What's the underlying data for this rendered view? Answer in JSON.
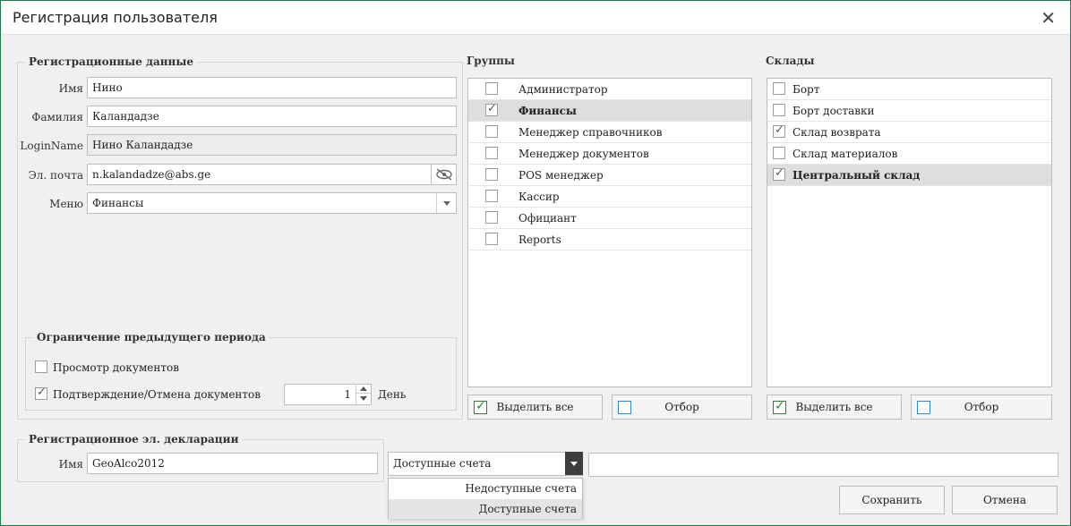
{
  "window": {
    "title": "Регистрация пользователя",
    "close_glyph": "✕"
  },
  "registration": {
    "legend": "Регистрационные данные",
    "first_name": {
      "label": "Имя",
      "value": "Нино"
    },
    "last_name": {
      "label": "Фамилия",
      "value": "Каландадзе"
    },
    "login": {
      "label": "LoginName",
      "value": "Нино Каландадзе"
    },
    "email": {
      "label": "Эл. почта",
      "value": "n.kalandadze@abs.ge",
      "icon": "eye-hidden-icon"
    },
    "menu": {
      "label": "Меню",
      "value": "Финансы"
    }
  },
  "restriction": {
    "legend": "Ограничение предыдущего периода",
    "view_docs": {
      "label": "Просмотр документов",
      "checked": false
    },
    "confirm_docs": {
      "label": "Подтверждение/Отмена документов",
      "checked": true
    },
    "days": {
      "value": "1",
      "unit": "День"
    }
  },
  "groups": {
    "legend": "Группы",
    "items": [
      {
        "label": "Администратор",
        "checked": false
      },
      {
        "label": "Финансы",
        "checked": true
      },
      {
        "label": "Менеджер справочников",
        "checked": false
      },
      {
        "label": "Менеджер документов",
        "checked": false
      },
      {
        "label": "POS менеджер",
        "checked": false
      },
      {
        "label": "Кассир",
        "checked": false
      },
      {
        "label": "Официант",
        "checked": false
      },
      {
        "label": "Reports",
        "checked": false
      }
    ],
    "select_all": "Выделить все",
    "filter": "Отбор"
  },
  "warehouses": {
    "legend": "Склады",
    "items": [
      {
        "label": "Борт",
        "checked": false
      },
      {
        "label": "Борт доставки",
        "checked": false
      },
      {
        "label": "Склад возврата",
        "checked": true
      },
      {
        "label": "Склад материалов",
        "checked": false
      },
      {
        "label": "Центральный склад",
        "checked": true
      }
    ],
    "select_all": "Выделить все",
    "filter": "Отбор"
  },
  "declaration": {
    "legend": "Регистрационное эл. декларации",
    "name": {
      "label": "Имя",
      "value": "GeoAlco2012"
    },
    "accounts": {
      "selected": "Доступные счета",
      "options": [
        "Недоступные счета",
        "Доступные счета"
      ]
    },
    "extra_value": ""
  },
  "buttons": {
    "save": "Сохранить",
    "cancel": "Отмена"
  }
}
